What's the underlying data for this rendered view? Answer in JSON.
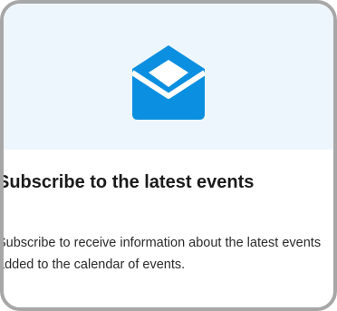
{
  "card": {
    "icon": "envelope-open-icon",
    "title": "Subscribe to the latest events",
    "description": "Subscribe to receive information about the latest events added to the calendar of events."
  },
  "colors": {
    "hero_background": "#eef6fd",
    "icon": "#0b8fe0",
    "title_text": "#1b1b1b",
    "body_text": "#2a2a2a",
    "frame_border": "#a7a7a7"
  }
}
